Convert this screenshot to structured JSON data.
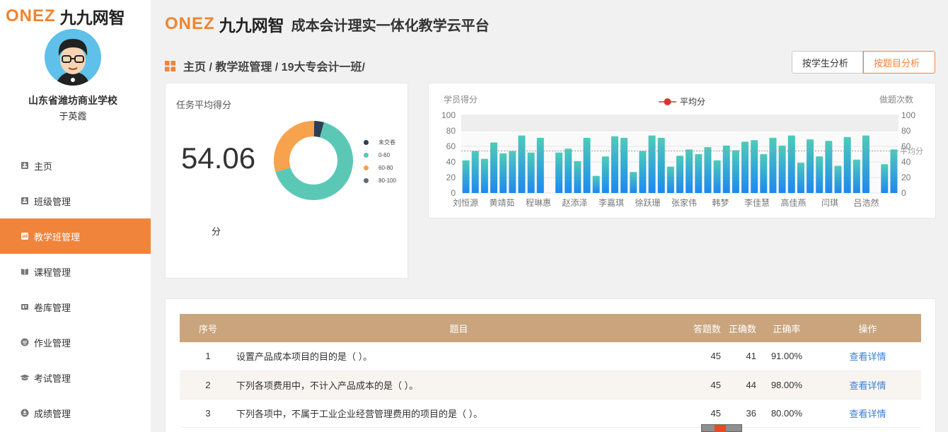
{
  "sidebar": {
    "logo_onez": "ONEZ",
    "logo_brand": "九九网智",
    "school": "山东省潍坊商业学校",
    "teacher": "于英霞",
    "menu": [
      {
        "label": "主页",
        "icon": "home-icon",
        "active": false
      },
      {
        "label": "班级管理",
        "icon": "class-icon",
        "active": false
      },
      {
        "label": "教学班管理",
        "icon": "teaching-class-icon",
        "active": true
      },
      {
        "label": "课程管理",
        "icon": "book-icon",
        "active": false
      },
      {
        "label": "卷库管理",
        "icon": "paper-bank-icon",
        "active": false
      },
      {
        "label": "作业管理",
        "icon": "homework-icon",
        "active": false
      },
      {
        "label": "考试管理",
        "icon": "graduation-cap-icon",
        "active": false
      },
      {
        "label": "成绩管理",
        "icon": "grade-icon",
        "active": false
      }
    ]
  },
  "header": {
    "logo_onez": "ONEZ",
    "logo_brand": "九九网智",
    "platform": "成本会计理实一体化教学云平台"
  },
  "breadcrumb": "主页 / 教学班管理 / 19大专会计一班/",
  "toggles": {
    "by_student": "按学生分析",
    "by_question": "按题目分析",
    "active": "by_question"
  },
  "score_card": {
    "title": "任务平均得分",
    "score": "54.06",
    "unit": "分",
    "legend": [
      {
        "label": "未交卷",
        "color": "#2f3e52"
      },
      {
        "label": "0-60",
        "color": "#5bc8b6"
      },
      {
        "label": "60-80",
        "color": "#f7a24c"
      },
      {
        "label": "80-100",
        "color": "#5c6a7a"
      }
    ],
    "distribution": [
      {
        "label": "未交卷",
        "value": 4,
        "color": "#2f3e52"
      },
      {
        "label": "0-60",
        "value": 66,
        "color": "#5bc8b6"
      },
      {
        "label": "60-80",
        "value": 30,
        "color": "#f7a24c"
      },
      {
        "label": "80-100",
        "value": 0,
        "color": "#5c6a7a"
      }
    ]
  },
  "chart_data": {
    "type": "bar",
    "ylabel": "学员得分",
    "y2label": "做题次数",
    "legend": "平均分",
    "ylim": [
      0,
      100
    ],
    "yticks": [
      0,
      20,
      40,
      60,
      80,
      100
    ],
    "average": 54.06,
    "average_label": "平均分",
    "x_tick_labels": [
      "刘恒源",
      "黄靖茹",
      "程琳惠",
      "赵添泽",
      "李嘉琪",
      "徐跃珊",
      "张家伟",
      "韩梦",
      "李佳慧",
      "高佳燕",
      "闫琪",
      "吕浩然"
    ],
    "values": [
      42,
      54,
      44,
      65,
      51,
      54,
      74,
      52,
      71,
      0,
      52,
      57,
      41,
      71,
      22,
      47,
      73,
      71,
      27,
      54,
      74,
      71,
      34,
      48,
      56,
      50,
      59,
      42,
      61,
      55,
      66,
      68,
      50,
      71,
      61,
      74,
      39,
      69,
      47,
      67,
      35,
      72,
      43,
      74,
      0,
      37,
      56
    ],
    "colors": {
      "bar_top": "#4ecbb9",
      "bar_bottom": "#1e88f0",
      "average": "#d23a30"
    }
  },
  "table": {
    "headers": [
      "序号",
      "题目",
      "答题数",
      "正确数",
      "正确率",
      "操作"
    ],
    "rows": [
      {
        "idx": "1",
        "question": "设置产品成本项目的目的是（ ）。",
        "answered": "45",
        "correct": "41",
        "rate": "91.00%",
        "action": "查看详情"
      },
      {
        "idx": "2",
        "question": "下列各项费用中，不计入产品成本的是（ ）。",
        "answered": "45",
        "correct": "44",
        "rate": "98.00%",
        "action": "查看详情"
      },
      {
        "idx": "3",
        "question": "下列各项中，不属于工业企业经营管理费用的项目的是（ ）。",
        "answered": "45",
        "correct": "36",
        "rate": "80.00%",
        "action": "查看详情"
      }
    ]
  }
}
